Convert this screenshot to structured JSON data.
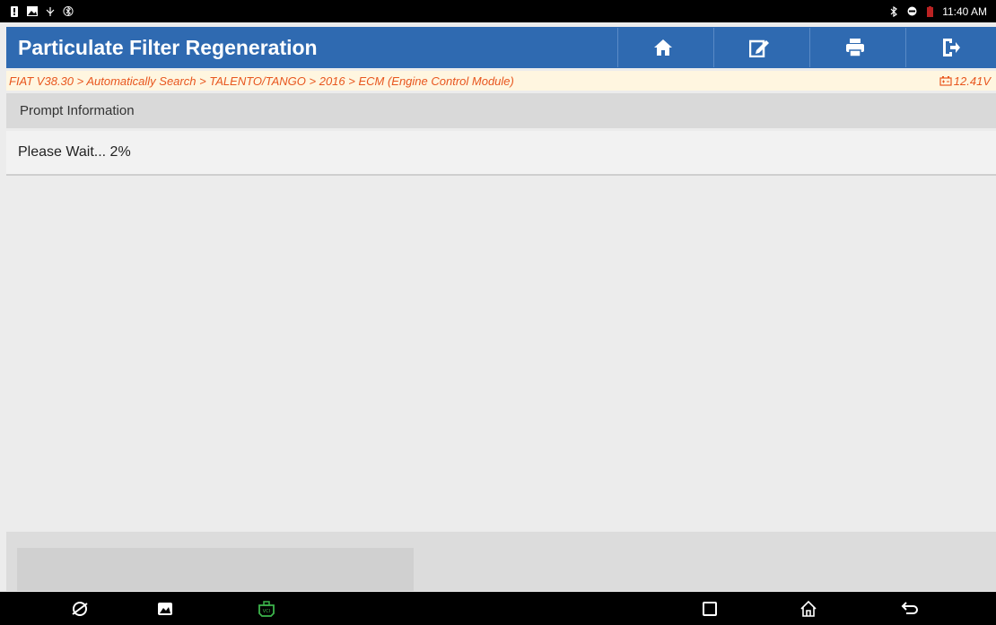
{
  "status_bar": {
    "time": "11:40 AM",
    "left_icons": [
      "notification-icon",
      "image-icon",
      "usb-icon",
      "bluetooth-icon"
    ],
    "right_icons": [
      "bluetooth-icon",
      "do-not-disturb-icon",
      "battery-icon"
    ]
  },
  "header": {
    "title": "Particulate Filter Regeneration",
    "buttons": [
      "home-icon",
      "edit-icon",
      "print-icon",
      "exit-icon"
    ],
    "background_color": "#2f6ab1"
  },
  "breadcrumb": {
    "path": "FIAT V38.30 > Automatically Search > TALENTO/TANGO > 2016 > ECM (Engine Control Module)",
    "voltage": "12.41V",
    "text_color": "#e8561e"
  },
  "prompt": {
    "header": "Prompt Information",
    "message": "Please Wait... 2%"
  },
  "nav_bar": {
    "icons": [
      "browser-icon",
      "gallery-icon",
      "vci-icon",
      "recent-apps-icon",
      "home-icon",
      "back-icon"
    ]
  }
}
